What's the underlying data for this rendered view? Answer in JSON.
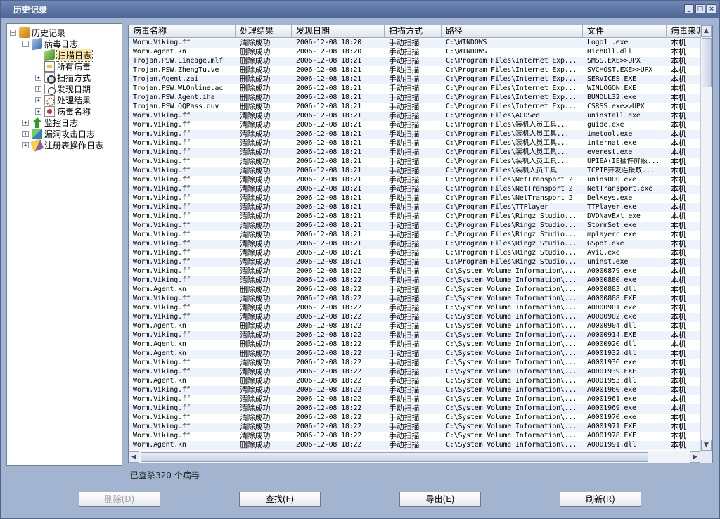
{
  "window": {
    "title": "历史记录",
    "buttons": [
      "_",
      "□",
      "×"
    ]
  },
  "tree": [
    {
      "label": "历史记录",
      "icon": "root-folder-icon",
      "level": 0,
      "exp": "−"
    },
    {
      "label": "病毒日志",
      "icon": "book-icon",
      "level": 1,
      "exp": "−"
    },
    {
      "label": "扫描日志",
      "icon": "green-book-icon",
      "level": 2,
      "exp": "",
      "selected": true
    },
    {
      "label": "所有病毒",
      "icon": "document-icon",
      "level": 2,
      "exp": ""
    },
    {
      "label": "扫描方式",
      "icon": "magnifier-icon",
      "level": 2,
      "exp": "+"
    },
    {
      "label": "发现日期",
      "icon": "clock-icon",
      "level": 2,
      "exp": "+"
    },
    {
      "label": "处理结果",
      "icon": "gear-icon",
      "level": 2,
      "exp": "+"
    },
    {
      "label": "病毒名称",
      "icon": "virus-icon",
      "level": 2,
      "exp": "+"
    },
    {
      "label": "监控日志",
      "icon": "green-arrow-icon",
      "level": 1,
      "exp": "+"
    },
    {
      "label": "漏洞攻击日志",
      "icon": "cube-icon",
      "level": 1,
      "exp": "+"
    },
    {
      "label": "注册表操作日志",
      "icon": "pencil-icon",
      "level": 1,
      "exp": "+"
    }
  ],
  "columns": [
    "病毒名称",
    "处理结果",
    "发现日期",
    "扫描方式",
    "路径",
    "文件",
    "病毒来源"
  ],
  "rows": [
    [
      "Worm.Viking.ff",
      "清除成功",
      "2006-12-08 18:20",
      "手动扫描",
      "C:\\WINDOWS",
      "Logo1_.exe",
      "本机"
    ],
    [
      "Worm.Agent.kn",
      "删除成功",
      "2006-12-08 18:20",
      "手动扫描",
      "C:\\WINDOWS",
      "RichDll.dll",
      "本机"
    ],
    [
      "Trojan.PSW.Lineage.mlf",
      "删除成功",
      "2006-12-08 18:21",
      "手动扫描",
      "C:\\Program Files\\Internet Exp...",
      "SMSS.EXE>>UPX",
      "本机"
    ],
    [
      "Trojan.PSW.ZhengTu.ve",
      "删除成功",
      "2006-12-08 18:21",
      "手动扫描",
      "C:\\Program Files\\Internet Exp...",
      "SVCHOST.EXE>>UPX",
      "本机"
    ],
    [
      "Trojan.Agent.zai",
      "删除成功",
      "2006-12-08 18:21",
      "手动扫描",
      "C:\\Program Files\\Internet Exp...",
      "SERVICES.EXE",
      "本机"
    ],
    [
      "Trojan.PSW.WLOnline.ac",
      "删除成功",
      "2006-12-08 18:21",
      "手动扫描",
      "C:\\Program Files\\Internet Exp...",
      "WINLOGON.EXE",
      "本机"
    ],
    [
      "Trojan.PSW.Agent.iha",
      "删除成功",
      "2006-12-08 18:21",
      "手动扫描",
      "C:\\Program Files\\Internet Exp...",
      "BUNDLL32.exe",
      "本机"
    ],
    [
      "Trojan.PSW.QQPass.quv",
      "删除成功",
      "2006-12-08 18:21",
      "手动扫描",
      "C:\\Program Files\\Internet Exp...",
      "CSRSS.exe>>UPX",
      "本机"
    ],
    [
      "Worm.Viking.ff",
      "清除成功",
      "2006-12-08 18:21",
      "手动扫描",
      "C:\\Program Files\\ACDSee",
      "uninstall.exe",
      "本机"
    ],
    [
      "Worm.Viking.ff",
      "清除成功",
      "2006-12-08 18:21",
      "手动扫描",
      "C:\\Program Files\\装机人员工具...",
      "guide.exe",
      "本机"
    ],
    [
      "Worm.Viking.ff",
      "清除成功",
      "2006-12-08 18:21",
      "手动扫描",
      "C:\\Program Files\\装机人员工具...",
      "imetool.exe",
      "本机"
    ],
    [
      "Worm.Viking.ff",
      "清除成功",
      "2006-12-08 18:21",
      "手动扫描",
      "C:\\Program Files\\装机人员工具...",
      "internat.exe",
      "本机"
    ],
    [
      "Worm.Viking.ff",
      "清除成功",
      "2006-12-08 18:21",
      "手动扫描",
      "C:\\Program Files\\装机人员工具...",
      "everest.exe",
      "本机"
    ],
    [
      "Worm.Viking.ff",
      "清除成功",
      "2006-12-08 18:21",
      "手动扫描",
      "C:\\Program Files\\装机人员工具...",
      "UPIEA(IE插件屏蔽...",
      "本机"
    ],
    [
      "Worm.Viking.ff",
      "清除成功",
      "2006-12-08 18:21",
      "手动扫描",
      "C:\\Program Files\\装机人员工具",
      "TCPIP并发连接数...",
      "本机"
    ],
    [
      "Worm.Viking.ff",
      "清除成功",
      "2006-12-08 18:21",
      "手动扫描",
      "C:\\Program Files\\NetTransport 2",
      "unins000.exe",
      "本机"
    ],
    [
      "Worm.Viking.ff",
      "清除成功",
      "2006-12-08 18:21",
      "手动扫描",
      "C:\\Program Files\\NetTransport 2",
      "NetTransport.exe",
      "本机"
    ],
    [
      "Worm.Viking.ff",
      "清除成功",
      "2006-12-08 18:21",
      "手动扫描",
      "C:\\Program Files\\NetTransport 2",
      "DelKeys.exe",
      "本机"
    ],
    [
      "Worm.Viking.ff",
      "清除成功",
      "2006-12-08 18:21",
      "手动扫描",
      "C:\\Program Files\\TTPlayer",
      "TTPlayer.exe",
      "本机"
    ],
    [
      "Worm.Viking.ff",
      "清除成功",
      "2006-12-08 18:21",
      "手动扫描",
      "C:\\Program Files\\Ringz Studio...",
      "DVDNavExt.exe",
      "本机"
    ],
    [
      "Worm.Viking.ff",
      "清除成功",
      "2006-12-08 18:21",
      "手动扫描",
      "C:\\Program Files\\Ringz Studio...",
      "StormSet.exe",
      "本机"
    ],
    [
      "Worm.Viking.ff",
      "清除成功",
      "2006-12-08 18:21",
      "手动扫描",
      "C:\\Program Files\\Ringz Studio...",
      "mplayerc.exe",
      "本机"
    ],
    [
      "Worm.Viking.ff",
      "清除成功",
      "2006-12-08 18:21",
      "手动扫描",
      "C:\\Program Files\\Ringz Studio...",
      "GSpot.exe",
      "本机"
    ],
    [
      "Worm.Viking.ff",
      "清除成功",
      "2006-12-08 18:21",
      "手动扫描",
      "C:\\Program Files\\Ringz Studio...",
      "AviC.exe",
      "本机"
    ],
    [
      "Worm.Viking.ff",
      "清除成功",
      "2006-12-08 18:21",
      "手动扫描",
      "C:\\Program Files\\Ringz Studio...",
      "uninst.exe",
      "本机"
    ],
    [
      "Worm.Viking.ff",
      "清除成功",
      "2006-12-08 18:22",
      "手动扫描",
      "C:\\System Volume Information\\...",
      "A0000879.exe",
      "本机"
    ],
    [
      "Worm.Viking.ff",
      "清除成功",
      "2006-12-08 18:22",
      "手动扫描",
      "C:\\System Volume Information\\...",
      "A0000880.exe",
      "本机"
    ],
    [
      "Worm.Agent.kn",
      "删除成功",
      "2006-12-08 18:22",
      "手动扫描",
      "C:\\System Volume Information\\...",
      "A0000883.dll",
      "本机"
    ],
    [
      "Worm.Viking.ff",
      "清除成功",
      "2006-12-08 18:22",
      "手动扫描",
      "C:\\System Volume Information\\...",
      "A0000888.EXE",
      "本机"
    ],
    [
      "Worm.Viking.ff",
      "清除成功",
      "2006-12-08 18:22",
      "手动扫描",
      "C:\\System Volume Information\\...",
      "A0000901.exe",
      "本机"
    ],
    [
      "Worm.Viking.ff",
      "清除成功",
      "2006-12-08 18:22",
      "手动扫描",
      "C:\\System Volume Information\\...",
      "A0000902.exe",
      "本机"
    ],
    [
      "Worm.Agent.kn",
      "删除成功",
      "2006-12-08 18:22",
      "手动扫描",
      "C:\\System Volume Information\\...",
      "A0000904.dll",
      "本机"
    ],
    [
      "Worm.Viking.ff",
      "清除成功",
      "2006-12-08 18:22",
      "手动扫描",
      "C:\\System Volume Information\\...",
      "A0000914.EXE",
      "本机"
    ],
    [
      "Worm.Agent.kn",
      "删除成功",
      "2006-12-08 18:22",
      "手动扫描",
      "C:\\System Volume Information\\...",
      "A0000920.dll",
      "本机"
    ],
    [
      "Worm.Agent.kn",
      "删除成功",
      "2006-12-08 18:22",
      "手动扫描",
      "C:\\System Volume Information\\...",
      "A0001932.dll",
      "本机"
    ],
    [
      "Worm.Viking.ff",
      "清除成功",
      "2006-12-08 18:22",
      "手动扫描",
      "C:\\System Volume Information\\...",
      "A0001936.exe",
      "本机"
    ],
    [
      "Worm.Viking.ff",
      "清除成功",
      "2006-12-08 18:22",
      "手动扫描",
      "C:\\System Volume Information\\...",
      "A0001939.EXE",
      "本机"
    ],
    [
      "Worm.Agent.kn",
      "删除成功",
      "2006-12-08 18:22",
      "手动扫描",
      "C:\\System Volume Information\\...",
      "A0001953.dll",
      "本机"
    ],
    [
      "Worm.Viking.ff",
      "清除成功",
      "2006-12-08 18:22",
      "手动扫描",
      "C:\\System Volume Information\\...",
      "A0001960.exe",
      "本机"
    ],
    [
      "Worm.Viking.ff",
      "清除成功",
      "2006-12-08 18:22",
      "手动扫描",
      "C:\\System Volume Information\\...",
      "A0001961.exe",
      "本机"
    ],
    [
      "Worm.Viking.ff",
      "清除成功",
      "2006-12-08 18:22",
      "手动扫描",
      "C:\\System Volume Information\\...",
      "A0001969.exe",
      "本机"
    ],
    [
      "Worm.Viking.ff",
      "清除成功",
      "2006-12-08 18:22",
      "手动扫描",
      "C:\\System Volume Information\\...",
      "A0001970.exe",
      "本机"
    ],
    [
      "Worm.Viking.ff",
      "清除成功",
      "2006-12-08 18:22",
      "手动扫描",
      "C:\\System Volume Information\\...",
      "A0001971.EXE",
      "本机"
    ],
    [
      "Worm.Viking.ff",
      "清除成功",
      "2006-12-08 18:22",
      "手动扫描",
      "C:\\System Volume Information\\...",
      "A0001978.EXE",
      "本机"
    ],
    [
      "Worm.Agent.kn",
      "删除成功",
      "2006-12-08 18:22",
      "手动扫描",
      "C:\\System Volume Information\\...",
      "A0001991.dll",
      "本机"
    ]
  ],
  "status": "已查杀320 个病毒",
  "buttons": {
    "delete": "删除(D)",
    "find": "查找(F)",
    "export": "导出(E)",
    "refresh": "刷新(R)"
  },
  "colors": {
    "window_bg": "#a3b4d1",
    "title_bg": "#4e6796",
    "selected_bg": "#fbe8a9"
  }
}
